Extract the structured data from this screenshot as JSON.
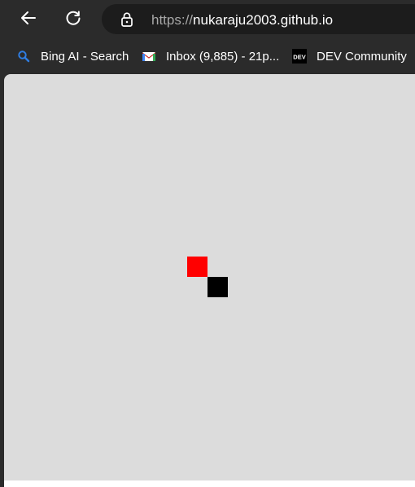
{
  "window": {
    "url_protocol": "https://",
    "url_host": "nukaraju2003.github.io"
  },
  "bookmarks": [
    {
      "label": "Bing AI - Search",
      "icon": "bing-search-icon"
    },
    {
      "label": "Inbox (9,885) - 21p...",
      "icon": "gmail-icon"
    },
    {
      "label": "DEV Community",
      "icon": "dev-icon"
    }
  ],
  "game": {
    "background_color": "#dcdcdc",
    "food_color": "#ff0000",
    "snake_color": "#000000"
  }
}
